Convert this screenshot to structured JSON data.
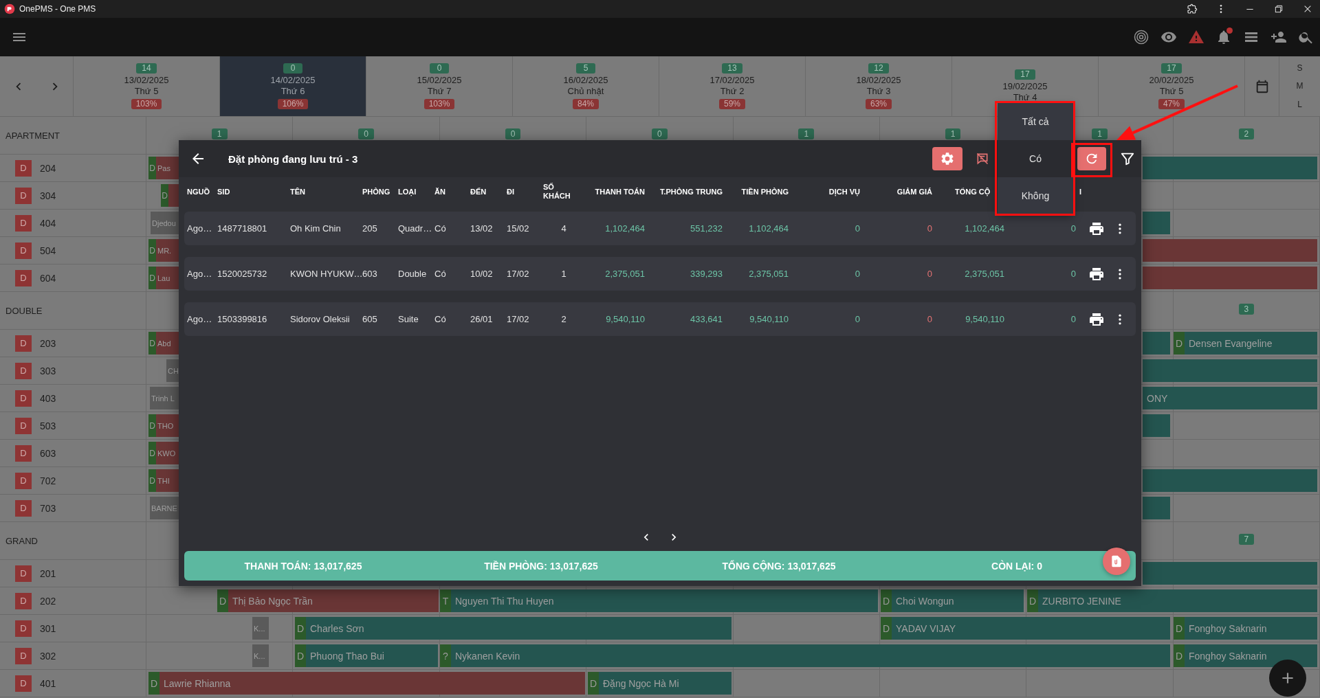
{
  "window": {
    "title": "OnePMS - One PMS"
  },
  "toolbar": {
    "notification_dot": true
  },
  "days": [
    {
      "count": "14",
      "date": "13/02/2025",
      "weekday": "Thứ 5",
      "occupancy": "103%",
      "selected": false
    },
    {
      "count": "0",
      "date": "14/02/2025",
      "weekday": "Thứ 6",
      "occupancy": "106%",
      "selected": true
    },
    {
      "count": "0",
      "date": "15/02/2025",
      "weekday": "Thứ 7",
      "occupancy": "103%",
      "selected": false
    },
    {
      "count": "5",
      "date": "16/02/2025",
      "weekday": "Chủ nhật",
      "occupancy": "84%",
      "selected": false
    },
    {
      "count": "13",
      "date": "17/02/2025",
      "weekday": "Thứ 2",
      "occupancy": "59%",
      "selected": false
    },
    {
      "count": "12",
      "date": "18/02/2025",
      "weekday": "Thứ 3",
      "occupancy": "63%",
      "selected": false
    },
    {
      "count": "17",
      "date": "19/02/2025",
      "weekday": "Thứ 4",
      "selected": false
    },
    {
      "count": "17",
      "date": "20/02/2025",
      "weekday": "Thứ 5",
      "occupancy": "47%",
      "selected": false
    }
  ],
  "view_sizes": [
    "S",
    "M",
    "L"
  ],
  "groups": [
    {
      "name": "APARTMENT",
      "counts": [
        "1",
        "0",
        "0",
        "0",
        "1",
        "1",
        "1",
        "2"
      ],
      "rooms": [
        {
          "status": "D",
          "number": "204",
          "bookings": [
            {
              "prefix": "D",
              "name": "Pas",
              "color": "#6a3636"
            },
            {
              "color": "#245550"
            }
          ]
        },
        {
          "status": "D",
          "number": "304",
          "bookings": [
            {
              "prefix": "D",
              "color": "#6a3636"
            }
          ]
        },
        {
          "status": "D",
          "number": "404",
          "bookings": [
            {
              "name": "Djedou",
              "color": "#5a5a5a"
            },
            {
              "color": "#245550"
            }
          ]
        },
        {
          "status": "D",
          "number": "504",
          "bookings": [
            {
              "prefix": "D",
              "name": "MR.",
              "color": "#6a3636"
            },
            {
              "color": "#6a3636"
            }
          ]
        },
        {
          "status": "D",
          "number": "604",
          "bookings": [
            {
              "prefix": "D",
              "name": "Lau",
              "color": "#6a3636"
            },
            {
              "color": "#6a3636"
            }
          ]
        }
      ]
    },
    {
      "name": "DOUBLE",
      "counts": [
        "3"
      ],
      "rooms": [
        {
          "status": "D",
          "number": "203",
          "bookings": [
            {
              "prefix": "D",
              "name": "Abd",
              "color": "#6a3636"
            },
            {
              "color": "#245550"
            },
            {
              "prefix": "D",
              "name": "Densen Evangeline",
              "color": "#245550"
            }
          ]
        },
        {
          "status": "D",
          "number": "303",
          "bookings": [
            {
              "name": "CH",
              "color": "#5a5a5a"
            },
            {
              "color": "#245550"
            }
          ]
        },
        {
          "status": "D",
          "number": "403",
          "bookings": [
            {
              "name": "Trinh L",
              "color": "#5a5a5a"
            },
            {
              "name": "ONY",
              "color": "#245550"
            }
          ]
        },
        {
          "status": "D",
          "number": "503",
          "bookings": [
            {
              "prefix": "D",
              "name": "THO",
              "color": "#6a3636"
            },
            {
              "color": "#245550"
            }
          ]
        },
        {
          "status": "D",
          "number": "603",
          "bookings": [
            {
              "prefix": "D",
              "name": "KWO",
              "color": "#6a3636"
            }
          ]
        },
        {
          "status": "D",
          "number": "702",
          "bookings": [
            {
              "prefix": "D",
              "name": "THI",
              "color": "#6a3636"
            },
            {
              "color": "#245550"
            }
          ]
        },
        {
          "status": "D",
          "number": "703",
          "bookings": [
            {
              "name": "BARNE",
              "color": "#5a5a5a"
            },
            {
              "color": "#245550"
            }
          ]
        }
      ]
    },
    {
      "name": "GRAND",
      "counts": [
        "7"
      ],
      "rooms": [
        {
          "status": "D",
          "number": "201",
          "bookings": [
            {
              "color": "#245550"
            }
          ]
        },
        {
          "status": "D",
          "number": "202",
          "bookings": [
            {
              "prefix": "D",
              "name": "Thị Bảo Ngọc Trần",
              "color": "#6a3636"
            },
            {
              "prefix": "T",
              "name": "Nguyen Thi Thu Huyen",
              "color": "#245550"
            },
            {
              "prefix": "D",
              "name": "Choi Wongun",
              "color": "#245550"
            },
            {
              "prefix": "D",
              "name": "ZURBITO JENINE",
              "color": "#245550"
            }
          ]
        },
        {
          "status": "D",
          "number": "301",
          "bookings": [
            {
              "name": "K...",
              "color": "#5a5a5a"
            },
            {
              "prefix": "D",
              "name": "Charles Sơn",
              "color": "#245550"
            },
            {
              "prefix": "D",
              "name": "YADAV VIJAY",
              "color": "#245550"
            },
            {
              "prefix": "D",
              "name": "Fonghoy Saknarin",
              "color": "#245550"
            }
          ]
        },
        {
          "status": "D",
          "number": "302",
          "bookings": [
            {
              "name": "K...",
              "color": "#5a5a5a"
            },
            {
              "prefix": "D",
              "name": "Phuong Thao Bui",
              "color": "#245550"
            },
            {
              "prefix": "?",
              "name": "Nykanen Kevin",
              "color": "#245550"
            },
            {
              "prefix": "D",
              "name": "Fonghoy Saknarin",
              "color": "#245550"
            }
          ]
        },
        {
          "status": "D",
          "number": "401",
          "bookings": [
            {
              "prefix": "D",
              "name": "Lawrie Rhianna",
              "color": "#6a3636"
            },
            {
              "prefix": "D",
              "name": "Đặng Ngọc Hà Mi",
              "color": "#245550"
            }
          ]
        }
      ]
    }
  ],
  "modal": {
    "title": "Đặt phòng đang lưu trú - 3",
    "columns": [
      "NGUỒ",
      "SID",
      "TÊN",
      "PHÒNG",
      "LOẠI",
      "ĂN",
      "ĐẾN",
      "ĐI",
      "SỐ KHÁCH",
      "THANH TOÁN",
      "T.PHÒNG TRUNG",
      "TIỀN PHÒNG",
      "DỊCH VỤ",
      "GIẢM GIÁ",
      "TỔNG CỘ",
      "I"
    ],
    "rows": [
      [
        "Ago…",
        "1487718801",
        "Oh Kim Chin",
        "205",
        "Quadr…",
        "Có",
        "13/02",
        "15/02",
        "4",
        "1,102,464",
        "551,232",
        "1,102,464",
        "0",
        "0",
        "1,102,464",
        "0"
      ],
      [
        "Ago…",
        "1520025732",
        "KWON HYUKW…",
        "603",
        "Double",
        "Có",
        "10/02",
        "17/02",
        "1",
        "2,375,051",
        "339,293",
        "2,375,051",
        "0",
        "0",
        "2,375,051",
        "0"
      ],
      [
        "Ago…",
        "1503399816",
        "Sidorov Oleksii",
        "605",
        "Suite",
        "Có",
        "26/01",
        "17/02",
        "2",
        "9,540,110",
        "433,641",
        "9,540,110",
        "0",
        "0",
        "9,540,110",
        "0"
      ]
    ],
    "summary": [
      "THANH TOÁN: 13,017,625",
      "TIỀN PHÒNG: 13,017,625",
      "TỔNG CỘNG: 13,017,625",
      "CÒN LẠI: 0"
    ],
    "filter_menu": [
      {
        "label": "Tất cả",
        "selected": false
      },
      {
        "label": "Có",
        "selected": true
      },
      {
        "label": "Không",
        "selected": false
      }
    ]
  },
  "annotations": {
    "menu_frame": true,
    "button_frame": true,
    "arrow": true
  }
}
